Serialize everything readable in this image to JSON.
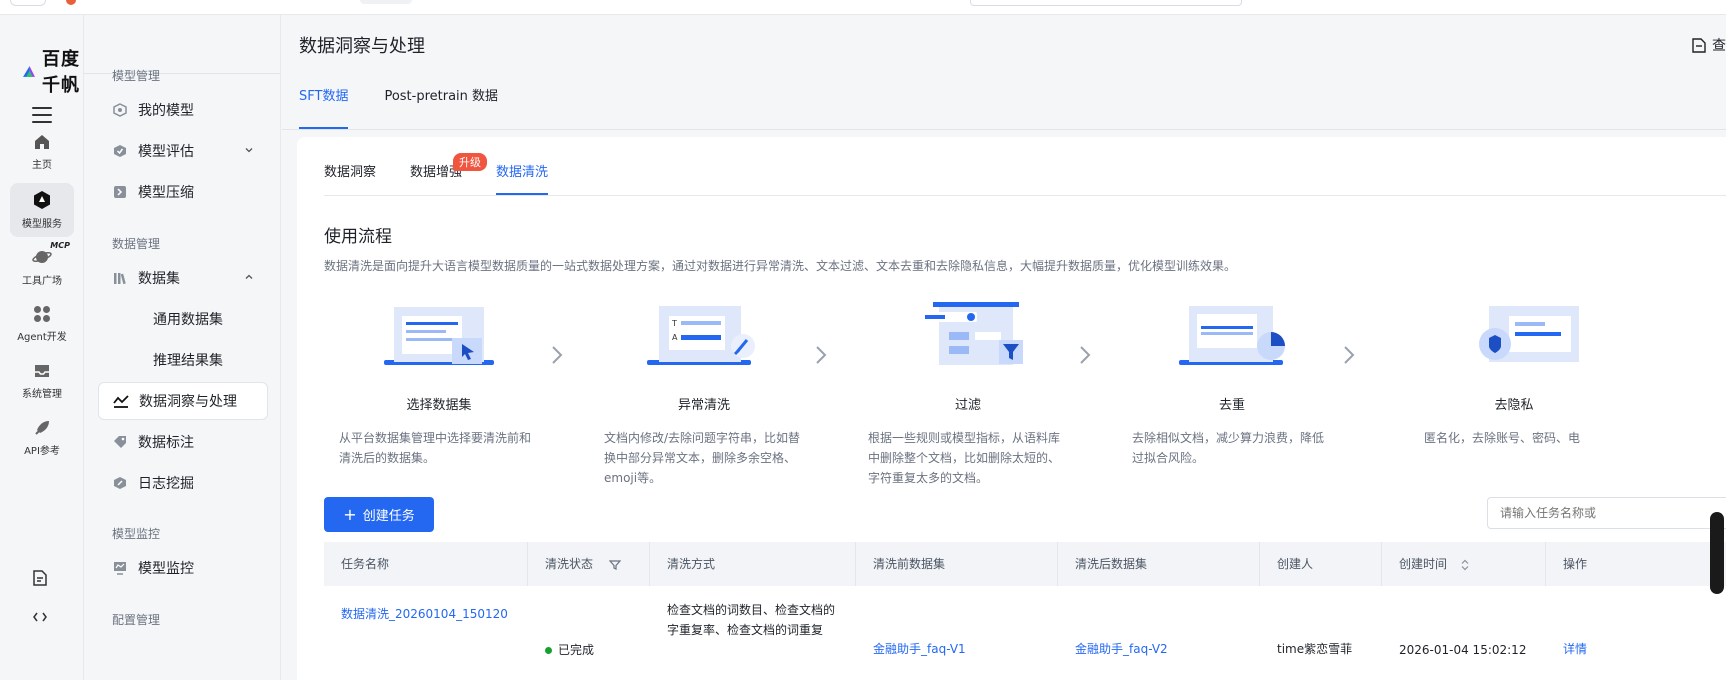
{
  "brand": {
    "name": "百度千帆"
  },
  "rail": {
    "items": [
      {
        "label": "主页",
        "icon": "home-icon"
      },
      {
        "label": "模型服务",
        "icon": "model-service-icon"
      },
      {
        "label": "工具广场",
        "icon": "tools-planet-icon",
        "tag": "MCP"
      },
      {
        "label": "Agent开发",
        "icon": "agent-grid-icon"
      },
      {
        "label": "系统管理",
        "icon": "inbox-icon"
      },
      {
        "label": "API参考",
        "icon": "api-rocket-icon"
      }
    ]
  },
  "sidebar": {
    "group_model": "模型管理",
    "my_model": "我的模型",
    "model_eval": "模型评估",
    "model_compress": "模型压缩",
    "group_data": "数据管理",
    "dataset": "数据集",
    "general_dataset": "通用数据集",
    "inference_dataset": "推理结果集",
    "data_insight": "数据洞察与处理",
    "data_label": "数据标注",
    "log_mining": "日志挖掘",
    "group_monitor": "模型监控",
    "model_monitor": "模型监控",
    "group_config": "配置管理"
  },
  "header": {
    "title": "数据洞察与处理",
    "doc_label": "查"
  },
  "tabs_top": [
    "SFT数据",
    "Post-pretrain 数据"
  ],
  "tabs_sub": [
    "数据洞察",
    "数据增强",
    "数据清洗"
  ],
  "sub_badge": "升级",
  "flow": {
    "title": "使用流程",
    "desc": "数据清洗是面向提升大语言模型数据质量的一站式数据处理方案，通过对数据进行异常清洗、文本过滤、文本去重和去除隐私信息，大幅提升数据质量，优化模型训练效果。",
    "steps": [
      {
        "title": "选择数据集",
        "desc": "从平台数据集管理中选择要清洗前和清洗后的数据集。"
      },
      {
        "title": "异常清洗",
        "desc": "文档内修改/去除问题字符串，比如替换中部分异常文本，删除多余空格、emoji等。"
      },
      {
        "title": "过滤",
        "desc": "根据一些规则或模型指标，从语料库中删除整个文档，比如删除太短的、字符重复太多的文档。"
      },
      {
        "title": "去重",
        "desc": "去除相似文档，减少算力浪费，降低过拟合风险。"
      },
      {
        "title": "去隐私",
        "desc": "匿名化，去除账号、密码、电"
      }
    ]
  },
  "toolbar": {
    "create_label": "创建任务",
    "search_placeholder": "请输入任务名称或"
  },
  "table": {
    "columns": [
      "任务名称",
      "清洗状态",
      "清洗方式",
      "清洗前数据集",
      "清洗后数据集",
      "创建人",
      "创建时间",
      "操作"
    ],
    "rows": [
      {
        "name": "数据清洗_20260104_150120",
        "status": "已完成",
        "method_line1": "检查文档的词数目、检查文档的",
        "method_line2": "字重复率、检查文档的词重复",
        "before": "金融助手_faq-V1",
        "after": "金融助手_faq-V2",
        "creator": "time紫恋雪菲",
        "created": "2026-01-04 15:02:12",
        "action": "详情"
      }
    ]
  },
  "colors": {
    "accent": "#2468f2",
    "success": "#15a02f",
    "badge": "#f0553f"
  }
}
